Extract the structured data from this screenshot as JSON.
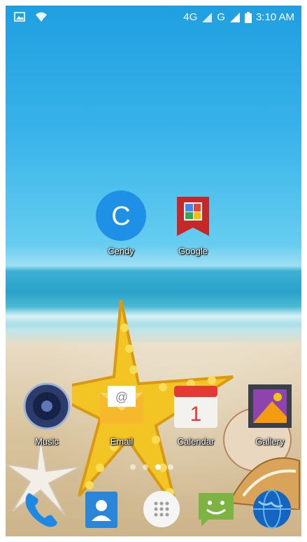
{
  "status_bar": {
    "network_1": "4G",
    "network_2": "G",
    "time": "3:10 AM",
    "icons": [
      "image-notification-icon",
      "wifi-icon",
      "signal-icon",
      "battery-icon"
    ]
  },
  "home_apps": [
    {
      "label": "Cendy",
      "icon": "contact-c-icon"
    },
    {
      "label": "Google",
      "icon": "google-folder-icon"
    }
  ],
  "apps_row": [
    {
      "label": "Music",
      "icon": "speaker-icon"
    },
    {
      "label": "Email",
      "icon": "email-icon"
    },
    {
      "label": "Calendar",
      "icon": "calendar-icon",
      "value": "1"
    },
    {
      "label": "Gallery",
      "icon": "gallery-icon"
    }
  ],
  "page_indicator": {
    "pages": 4,
    "active": 3
  },
  "dock": [
    {
      "icon": "phone-icon"
    },
    {
      "icon": "contacts-icon"
    },
    {
      "icon": "app-drawer-icon"
    },
    {
      "icon": "messaging-icon"
    },
    {
      "icon": "browser-globe-icon"
    }
  ],
  "colors": {
    "cendy_circle": "#1e90e6",
    "google_red": "#d32f2f",
    "calendar_red": "#e53935",
    "sms_green": "#7cb342"
  }
}
